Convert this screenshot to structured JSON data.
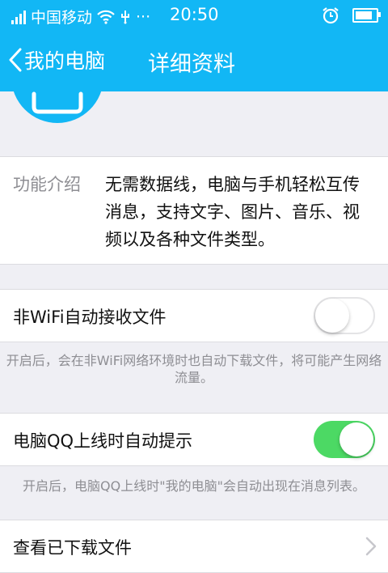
{
  "status": {
    "carrier": "中国移动",
    "extra": "···",
    "time": "20:50",
    "battery_level": 1.0
  },
  "nav": {
    "back_label": "我的电脑",
    "title": "详细资料"
  },
  "intro": {
    "label": "功能介绍",
    "text": "无需数据线，电脑与手机轻松互传消息，支持文字、图片、音乐、视频以及各种文件类型。"
  },
  "settings": {
    "wifi_auto_receive": {
      "label": "非WiFi自动接收文件",
      "enabled": false,
      "note": "开启后，会在非WiFi网络环境时也自动下载文件，将可能产生网络流量。"
    },
    "qq_online_alert": {
      "label": "电脑QQ上线时自动提示",
      "enabled": true,
      "note": "开启后，电脑QQ上线时\"我的电脑\"会自动出现在消息列表。"
    },
    "downloaded_files": {
      "label": "查看已下载文件"
    }
  },
  "colors": {
    "brand": "#12b7f5",
    "toggle_on": "#4cd964",
    "background": "#efeff4"
  }
}
